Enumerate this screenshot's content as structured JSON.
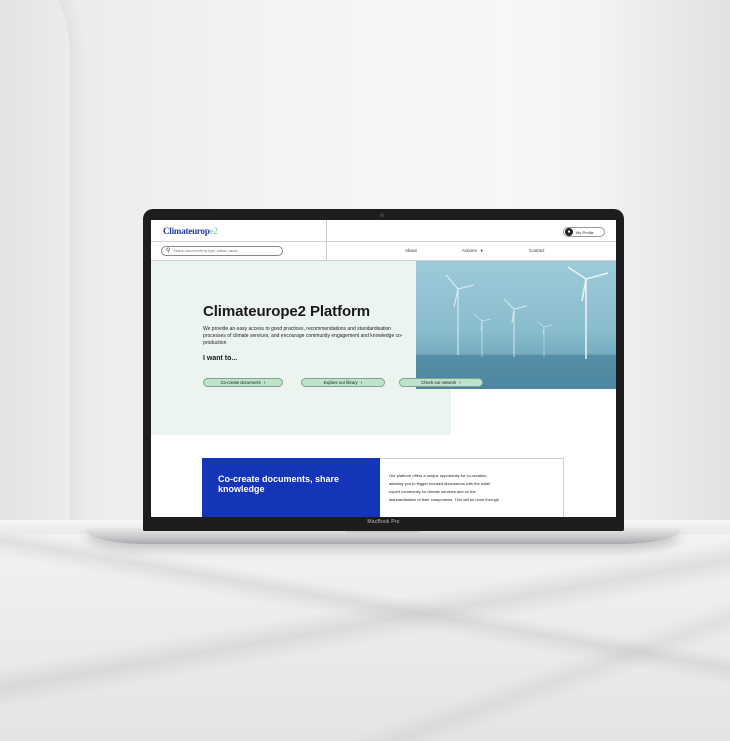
{
  "header": {
    "logo_part1": "Climateurop",
    "logo_part2": "e2",
    "profile_label": "My Profile",
    "search_placeholder": "Search documents by type, author, name..."
  },
  "nav": {
    "items": [
      {
        "label": "About"
      },
      {
        "label": "Actions"
      },
      {
        "label": "Contact"
      }
    ]
  },
  "hero": {
    "title": "Climateurope2 Platform",
    "description": "We provide an easy access to good practices, recommendations and standardisation processes of climate services, and encourage community engagement and knowledge co-production",
    "subheading": "I want to...",
    "buttons": [
      {
        "label": "Co-create documents"
      },
      {
        "label": "Explore our library"
      },
      {
        "label": "Check our network"
      }
    ]
  },
  "section2": {
    "heading": "Co-create documents, share knowledge",
    "lines": [
      "Our platform offers a unique opportunity for co-creation,",
      "allowing you to trigger focused discussions with the wider",
      "expert community on climate services and on the",
      "standardisation of their components. This will be done through"
    ]
  },
  "device": {
    "model_label": "MacBook Pro"
  },
  "colors": {
    "brand_blue": "#1435b8",
    "brand_green": "#6cc3a8",
    "hero_bg": "#ecf4ef",
    "button_green": "#bde3c8"
  }
}
